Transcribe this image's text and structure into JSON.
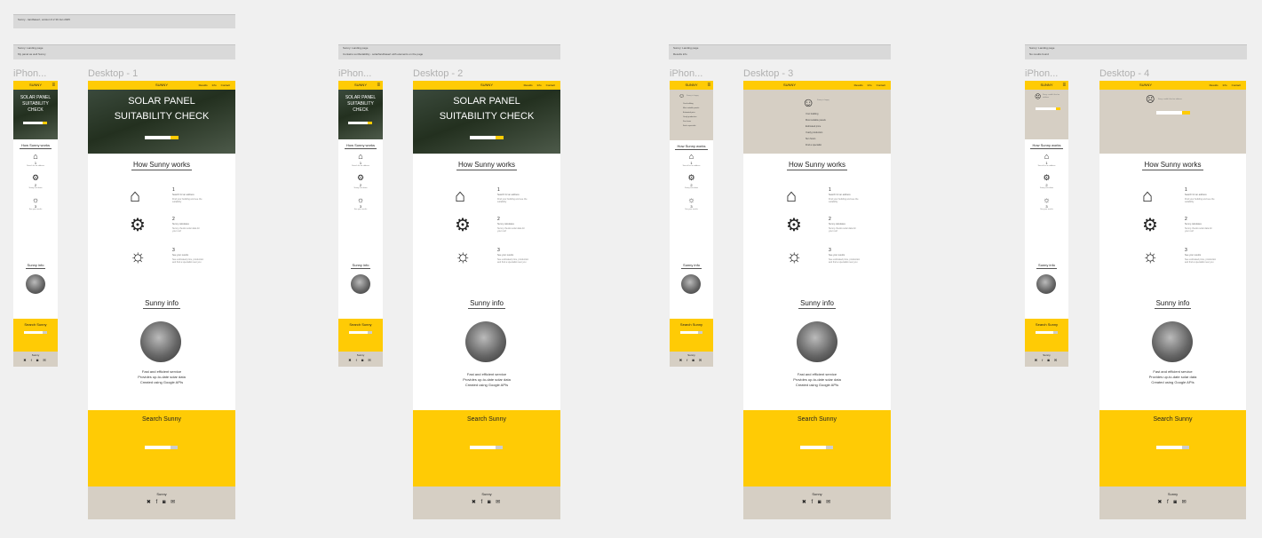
{
  "notes": [
    {
      "lines": [
        "Sunny - landbasert, version 0.2 30 Jan 2025"
      ]
    },
    {
      "lines": [
        "Sunny: Landing page",
        "My panel as well Sunny"
      ]
    },
    {
      "lines": [
        "Sunny: Landing page",
        "Contains sunSuitability - solar/landbasert with elements on the page"
      ]
    },
    {
      "lines": [
        "Sunny: Landing page",
        "Results info"
      ]
    },
    {
      "lines": [
        "Sunny: Landing page",
        "No results found"
      ]
    }
  ],
  "frames": [
    {
      "mobile_label": "iPhon...",
      "desktop_label": "Desktop - 1"
    },
    {
      "mobile_label": "iPhon...",
      "desktop_label": "Desktop - 2"
    },
    {
      "mobile_label": "iPhon...",
      "desktop_label": "Desktop - 3"
    },
    {
      "mobile_label": "iPhon...",
      "desktop_label": "Desktop - 4"
    }
  ],
  "nav": {
    "brand": "SUNNY",
    "links": [
      "Results",
      "Info",
      "Contact"
    ]
  },
  "hero": {
    "line1": "SOLAR PANEL",
    "line2": "SUITABILITY CHECK",
    "mobile_lines": [
      "SOLAR PANEL",
      "SUITABILITY",
      "CHECK"
    ]
  },
  "results": {
    "happy": "Sunny is happy",
    "sad": "Sorry, couldn't find an address",
    "items": [
      "Your building",
      "Most suitable panels",
      "Estimated price",
      "Yearly production",
      "Sun hours",
      "Find a specialist"
    ]
  },
  "how": {
    "title": "How Sunny works",
    "steps": [
      {
        "num": "1",
        "title": "Search for an address",
        "text": "Find your building and see the suitability"
      },
      {
        "num": "2",
        "title": "Sunny calculates",
        "text": "Sunny checks solar data for your roof"
      },
      {
        "num": "3",
        "title": "See your results",
        "text": "See estimated price, production and find a specialist near you"
      }
    ]
  },
  "info": {
    "title": "Sunny info",
    "lines": [
      "Fast and efficient service",
      "Provides up-to-date solar data",
      "Created using Google APIs"
    ]
  },
  "search": {
    "title": "Search Sunny"
  },
  "footer": {
    "brand": "Sunny",
    "icons": [
      "x-icon",
      "facebook-icon",
      "instagram-icon",
      "mail-icon"
    ]
  }
}
